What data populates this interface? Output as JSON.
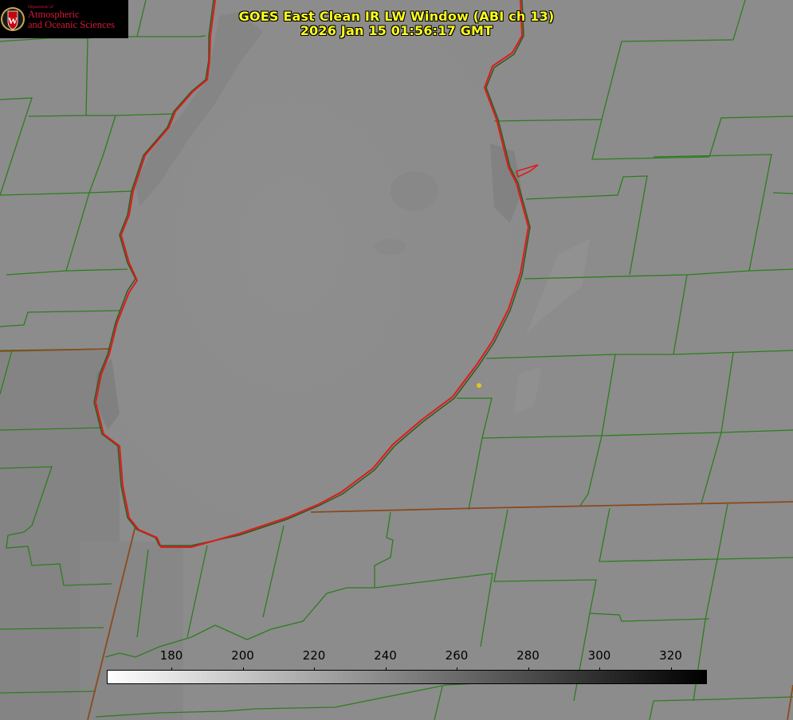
{
  "title": {
    "line1": "GOES East Clean IR LW Window (ABI ch 13)",
    "line2": "2026 Jan 15 01:56:17 GMT"
  },
  "logo": {
    "department": "Department of",
    "line1": "Atmospheric",
    "line2": "and Oceanic Sciences",
    "crest_letter": "W"
  },
  "colorbar": {
    "ticks": [
      "180",
      "200",
      "220",
      "240",
      "260",
      "280",
      "300",
      "320"
    ],
    "low_color": "#ffffff",
    "high_color": "#000000"
  },
  "colors": {
    "county_lines": "#2d7d1e",
    "coastline": "#e01a1a",
    "state_border": "#8b4a1e",
    "marker": "#e6c419",
    "title": "#ffff1e",
    "logo_red": "#d4193a"
  }
}
